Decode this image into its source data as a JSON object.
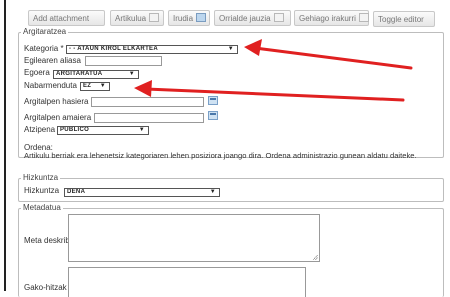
{
  "toolbar": {
    "buttons": [
      {
        "label": "Add attachment",
        "icon": "none"
      },
      {
        "label": "Artikulua",
        "icon": "page-icon"
      },
      {
        "label": "Irudia",
        "icon": "image-icon"
      },
      {
        "label": "Orrialde jauzia",
        "icon": "page-break-icon"
      },
      {
        "label": "Gehiago irakurri",
        "icon": "read-more-icon"
      },
      {
        "label": "Toggle editor",
        "icon": "none"
      }
    ]
  },
  "argitaratzea": {
    "legend": "Argitaratzea",
    "kategoria_label": "Kategoria *",
    "kategoria_value": "- - Ataun kirol elkartea",
    "aliasa_label": "Egilearen aliasa",
    "aliasa_value": "",
    "egoera_label": "Egoera",
    "egoera_value": "Argitaratua",
    "nabarmenduta_label": "Nabarmenduta",
    "nabarmenduta_value": "Ez",
    "hasiera_label": "Argitalpen hasiera",
    "hasiera_value": "",
    "amaiera_label": "Argitalpen amaiera",
    "amaiera_value": "",
    "atzipena_label": "Atzipena",
    "atzipena_value": "Publico",
    "ordena_title": "Ordena:",
    "ordena_text": "Artikulu berriak era lehenetsiz kategoriaren lehen posiziora joango dira. Ordena administrazio gunean aldatu daiteke."
  },
  "hizkuntza": {
    "legend": "Hizkuntza",
    "label": "Hizkuntza",
    "value": "Dena"
  },
  "metadatua": {
    "legend": "Metadatua",
    "meta_label": "Meta deskribapena",
    "meta_value": "",
    "gako_label": "Gako-hitzak",
    "gako_value": ""
  },
  "annotation": {
    "arrow_color": "#e02020"
  }
}
